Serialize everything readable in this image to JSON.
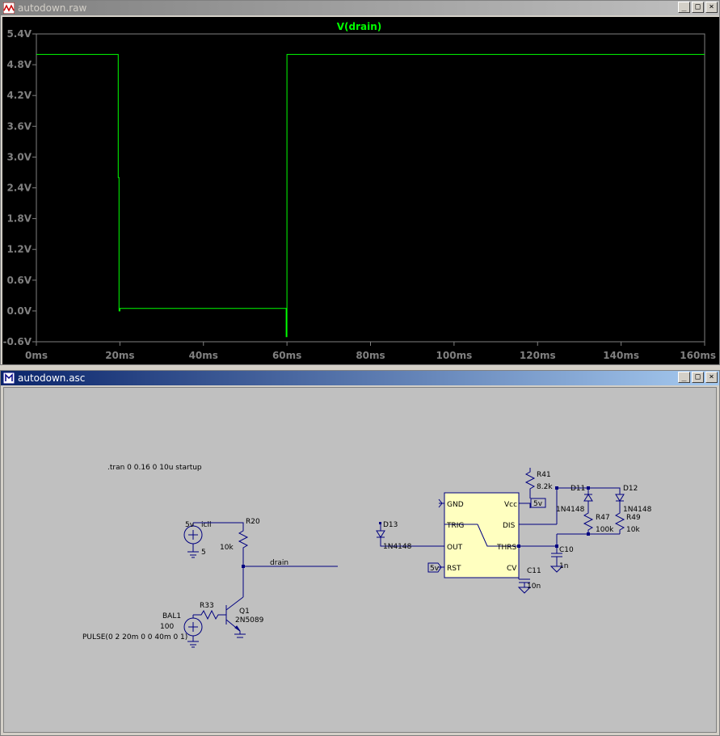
{
  "plot_window": {
    "title": "autodown.raw",
    "buttons": [
      "_",
      "□",
      "×"
    ]
  },
  "schematic_window": {
    "title": "autodown.asc",
    "buttons": [
      "_",
      "□",
      "×"
    ]
  },
  "chart_data": {
    "type": "line",
    "title": "V(drain)",
    "xlabel": "",
    "ylabel": "",
    "xlim": [
      0,
      160
    ],
    "ylim": [
      -0.6,
      5.4
    ],
    "x_ticks": [
      "0ms",
      "20ms",
      "40ms",
      "60ms",
      "80ms",
      "100ms",
      "120ms",
      "140ms",
      "160ms"
    ],
    "x_tick_values": [
      0,
      20,
      40,
      60,
      80,
      100,
      120,
      140,
      160
    ],
    "y_ticks": [
      "5.4V",
      "4.8V",
      "4.2V",
      "3.6V",
      "3.0V",
      "2.4V",
      "1.8V",
      "1.2V",
      "0.6V",
      "0.0V",
      "-0.6V"
    ],
    "y_tick_values": [
      5.4,
      4.8,
      4.2,
      3.6,
      3.0,
      2.4,
      1.8,
      1.2,
      0.6,
      0.0,
      -0.6
    ],
    "series": [
      {
        "name": "V(drain)",
        "color": "#00ff00",
        "x": [
          0,
          19.6,
          19.6,
          19.8,
          19.8,
          20,
          20,
          59.8,
          59.8,
          60,
          60,
          160
        ],
        "y": [
          5.0,
          5.0,
          2.6,
          2.6,
          0.0,
          0.0,
          0.05,
          0.05,
          -0.5,
          -0.5,
          5.0,
          5.0
        ]
      }
    ]
  },
  "schematic": {
    "directive": ".tran 0 0.16 0 10u startup",
    "net_drain": "drain",
    "v1": {
      "value": "5v",
      "name": "icll",
      "dc": "5"
    },
    "r20": {
      "name": "R20",
      "value": "10k"
    },
    "q1": {
      "name": "Q1",
      "model": "2N5089"
    },
    "r33": {
      "name": "R33",
      "value": "100"
    },
    "bal1": {
      "name": "BAL1",
      "value": "PULSE(0 2 20m 0 0 40m 0 1)"
    },
    "timer": {
      "pins": [
        "GND",
        "Vcc",
        "TRIG",
        "DIS",
        "OUT",
        "THRS",
        "RST",
        "CV"
      ]
    },
    "r41": {
      "name": "R41",
      "value": "8.2k"
    },
    "vcc_label": "5v",
    "rst_label": "5v",
    "d11": {
      "name": "D11",
      "model": "1N4148"
    },
    "d12": {
      "name": "D12",
      "model": "1N4148"
    },
    "d13": {
      "name": "D13",
      "model": "1N4148"
    },
    "r47": {
      "name": "R47",
      "value": "100k"
    },
    "r49": {
      "name": "R49",
      "value": "10k"
    },
    "c10": {
      "name": "C10",
      "value": "1n"
    },
    "c11": {
      "name": "C11",
      "value": "10n"
    }
  }
}
